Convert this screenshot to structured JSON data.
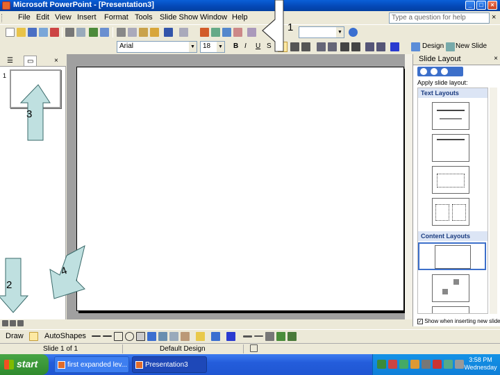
{
  "window": {
    "title": "Microsoft PowerPoint - [Presentation3]",
    "minimize": "_",
    "maximize": "□",
    "close": "×"
  },
  "menu": {
    "items": [
      "File",
      "Edit",
      "View",
      "Insert",
      "Format",
      "Tools",
      "Slide Show",
      "Window",
      "Help"
    ],
    "help_placeholder": "Type a question for help",
    "close": "×"
  },
  "format_toolbar": {
    "font": "Arial",
    "size": "18",
    "bold": "B",
    "italic": "I",
    "underline": "U",
    "shadow": "S",
    "design_label": "Design",
    "new_slide_label": "New Slide"
  },
  "outline_pane": {
    "slide_number": "1",
    "close": "×"
  },
  "task_pane": {
    "title": "Slide Layout",
    "close": "×",
    "apply_label": "Apply slide layout:",
    "text_layouts": "Text Layouts",
    "content_layouts": "Content Layouts",
    "show_when_inserting": "Show when inserting new slides"
  },
  "drawing_toolbar": {
    "draw_label": "Draw",
    "autoshapes_label": "AutoShapes"
  },
  "status": {
    "slide": "Slide 1 of 1",
    "design": "Default Design"
  },
  "taskbar": {
    "start": "start",
    "task1": "first expanded lev...",
    "task2": "Presentation3",
    "time": "3:58 PM",
    "day": "Wednesday"
  },
  "annotations": {
    "one": "1",
    "two": "2",
    "three": "3",
    "four": "4"
  }
}
